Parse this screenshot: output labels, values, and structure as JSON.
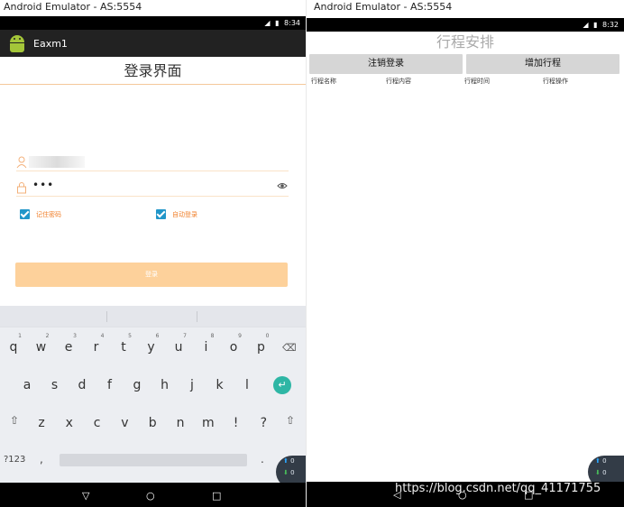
{
  "left_window": {
    "title": "Android Emulator - AS:5554",
    "status_time": "8:34",
    "app_name": "Eaxm1",
    "page_title": "登录界面",
    "password_mask": "•••",
    "remember_label": "记住密码",
    "auto_login_label": "自动登录",
    "login_button": "登录",
    "keyboard": {
      "row1": [
        "q",
        "w",
        "e",
        "r",
        "t",
        "y",
        "u",
        "i",
        "o",
        "p"
      ],
      "row1_hints": [
        "1",
        "2",
        "3",
        "4",
        "5",
        "6",
        "7",
        "8",
        "9",
        "0"
      ],
      "row2": [
        "a",
        "s",
        "d",
        "f",
        "g",
        "h",
        "j",
        "k",
        "l"
      ],
      "row3": [
        "z",
        "x",
        "c",
        "v",
        "b",
        "n",
        "m",
        "!",
        "?"
      ],
      "sym_key": "?123",
      "comma_key": ",",
      "period_key": "."
    },
    "widget": {
      "up": "0",
      "down": "0"
    }
  },
  "right_window": {
    "title": "Android Emulator - AS:5554",
    "status_time": "8:32",
    "page_title": "行程安排",
    "logout_button": "注销登录",
    "add_button": "增加行程",
    "columns": [
      "行程名称",
      "行程内容",
      "行程时间",
      "行程操作"
    ],
    "widget": {
      "up": "0",
      "down": "0"
    }
  },
  "watermark": "https://blog.csdn.net/qq_41171755"
}
